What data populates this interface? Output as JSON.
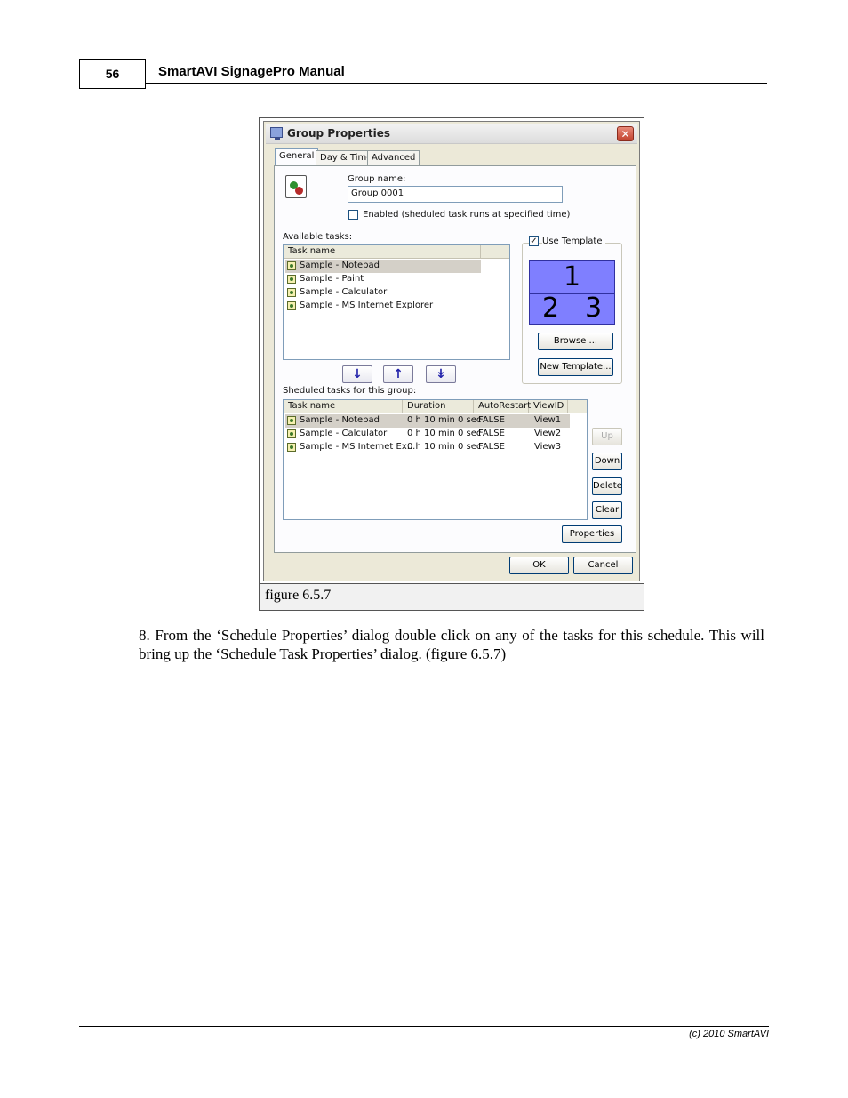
{
  "header": {
    "page_number": "56",
    "title": "SmartAVI SignagePro Manual"
  },
  "figure": {
    "caption": "figure 6.5.7",
    "dialog": {
      "title": "Group Properties",
      "close_glyph": "✕",
      "tabs": [
        "General",
        "Day & Time",
        "Advanced"
      ],
      "active_tab": "General",
      "group_name_label": "Group name:",
      "group_name_value": "Group 0001",
      "enabled_label": "Enabled (sheduled task runs at specified time)",
      "enabled_checked": false,
      "available_tasks_label": "Available tasks:",
      "available_column": "Task name",
      "available_tasks": [
        "Sample - Notepad",
        "Sample - Paint",
        "Sample - Calculator",
        "Sample - MS Internet Explorer"
      ],
      "use_template_label": "Use Template",
      "use_template_checked": true,
      "checkbox_mark": "✓",
      "template_cells": [
        "1",
        "2",
        "3"
      ],
      "browse_label": "Browse ...",
      "new_template_label": "New Template...",
      "arrow_buttons": [
        "↓",
        "↑",
        "↡"
      ],
      "scheduled_label": "Sheduled tasks for this group:",
      "scheduled_columns": [
        "Task name",
        "Duration",
        "AutoRestart",
        "ViewID"
      ],
      "scheduled_rows": [
        {
          "task": "Sample - Notepad",
          "duration": "0 h 10 min 0 sec",
          "autorestart": "FALSE",
          "viewid": "View1"
        },
        {
          "task": "Sample - Calculator",
          "duration": "0 h 10 min 0 sec",
          "autorestart": "FALSE",
          "viewid": "View2"
        },
        {
          "task": "Sample - MS Internet Ex...",
          "duration": "0 h 10 min 0 sec",
          "autorestart": "FALSE",
          "viewid": "View3"
        }
      ],
      "side_buttons": {
        "up": "Up",
        "down": "Down",
        "delete": "Delete",
        "clear": "Clear"
      },
      "properties_label": "Properties",
      "ok_label": "OK",
      "cancel_label": "Cancel",
      "colors": {
        "template_fill": "#7f7fff",
        "selection": "#d4d0c8",
        "close_button": "#c2432f"
      }
    }
  },
  "body_text": "8. From the ‘Schedule Properties’ dialog double click on any of the tasks for this schedule. This will bring up the ‘Schedule Task Properties’ dialog. (figure 6.5.7)",
  "footer": "(c) 2010 SmartAVI"
}
